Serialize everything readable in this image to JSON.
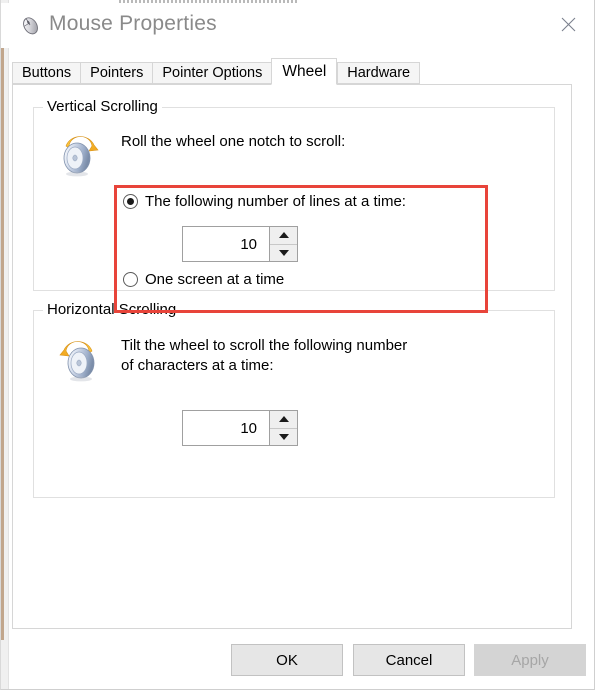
{
  "window": {
    "title": "Mouse Properties",
    "icon": "mouse-icon",
    "close_icon": "close-icon"
  },
  "tabs": [
    {
      "label": "Buttons",
      "active": false
    },
    {
      "label": "Pointers",
      "active": false
    },
    {
      "label": "Pointer Options",
      "active": false
    },
    {
      "label": "Wheel",
      "active": true
    },
    {
      "label": "Hardware",
      "active": false
    }
  ],
  "vertical_scrolling": {
    "group_title": "Vertical Scrolling",
    "icon": "vertical-wheel-icon",
    "prompt": "Roll the wheel one notch to scroll:",
    "option_lines": {
      "label": "The following number of lines at a time:",
      "selected": true
    },
    "option_screen": {
      "label": "One screen at a time",
      "selected": false
    },
    "spinner": {
      "value": "10",
      "up_icon": "caret-up-icon",
      "down_icon": "caret-down-icon"
    }
  },
  "horizontal_scrolling": {
    "group_title": "Horizontal Scrolling",
    "icon": "horizontal-wheel-icon",
    "prompt": "Tilt the wheel to scroll the following number\nof characters at a time:",
    "spinner": {
      "value": "10",
      "up_icon": "caret-up-icon",
      "down_icon": "caret-down-icon"
    }
  },
  "highlight": {
    "name": "red-highlight-rectangle",
    "color": "#e8443a"
  },
  "footer": {
    "ok_label": "OK",
    "cancel_label": "Cancel",
    "apply_label": "Apply",
    "apply_enabled": false
  },
  "colors": {
    "accent_red": "#e8443a",
    "title_text": "#8a8a8a",
    "dialog_bg": "#ffffff",
    "group_border": "#e0e0e0",
    "button_face": "#e6e6e6",
    "button_disabled": "#d4d4d4"
  }
}
